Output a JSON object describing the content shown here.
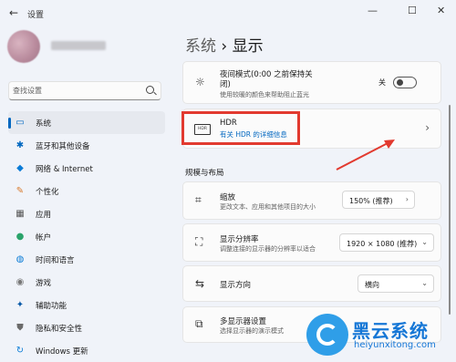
{
  "window": {
    "title": "设置",
    "back": "←",
    "minimize": "—",
    "maximize": "☐",
    "close": "✕"
  },
  "search": {
    "placeholder": "查找设置"
  },
  "sidebar": {
    "items": [
      {
        "label": "系统",
        "icon": "monitor-icon",
        "glyph": "▭",
        "color": "#0067c0",
        "active": true
      },
      {
        "label": "蓝牙和其他设备",
        "icon": "bluetooth-icon",
        "glyph": "✱",
        "color": "#0067c0"
      },
      {
        "label": "网络 & Internet",
        "icon": "wifi-icon",
        "glyph": "◆",
        "color": "#0a7bd6"
      },
      {
        "label": "个性化",
        "icon": "brush-icon",
        "glyph": "✎",
        "color": "#d97a2b"
      },
      {
        "label": "应用",
        "icon": "apps-icon",
        "glyph": "▦",
        "color": "#555555"
      },
      {
        "label": "帐户",
        "icon": "account-icon",
        "glyph": "●",
        "color": "#2aa36b"
      },
      {
        "label": "时间和语言",
        "icon": "globe-clock-icon",
        "glyph": "◍",
        "color": "#0a7bd6"
      },
      {
        "label": "游戏",
        "icon": "gamepad-icon",
        "glyph": "◉",
        "color": "#777777"
      },
      {
        "label": "辅助功能",
        "icon": "accessibility-icon",
        "glyph": "✦",
        "color": "#0a5aa8"
      },
      {
        "label": "隐私和安全性",
        "icon": "shield-icon",
        "glyph": "⛊",
        "color": "#6b6b6b"
      },
      {
        "label": "Windows 更新",
        "icon": "update-icon",
        "glyph": "↻",
        "color": "#0a7bd6"
      }
    ]
  },
  "breadcrumb": {
    "parent": "系统",
    "sep": " › ",
    "current": "显示"
  },
  "night": {
    "title": "夜间模式(0:00 之前保持关",
    "title2": "闭)",
    "desc": "使用较暖的颜色来帮助阻止蓝光",
    "state": "关"
  },
  "hdr": {
    "title": "HDR",
    "link": "有关 HDR 的详细信息",
    "icon_text": "HDR"
  },
  "section": {
    "title": "规模与布局"
  },
  "scale": {
    "title": "缩放",
    "desc": "更改文本、应用和其他项目的大小",
    "value": "150% (推荐)"
  },
  "resolution": {
    "title": "显示分辨率",
    "desc": "调整连接的显示器的分辨率以适合",
    "value": "1920 × 1080 (推荐)"
  },
  "orientation": {
    "title": "显示方向",
    "value": "横向"
  },
  "multi": {
    "title": "多显示器设置",
    "desc": "选择显示器的演示模式"
  },
  "watermark": {
    "brand": "黑云系统",
    "url": "heiyunxitong.com"
  },
  "colors": {
    "accent": "#0067c0",
    "annotation": "#e23a2f"
  }
}
